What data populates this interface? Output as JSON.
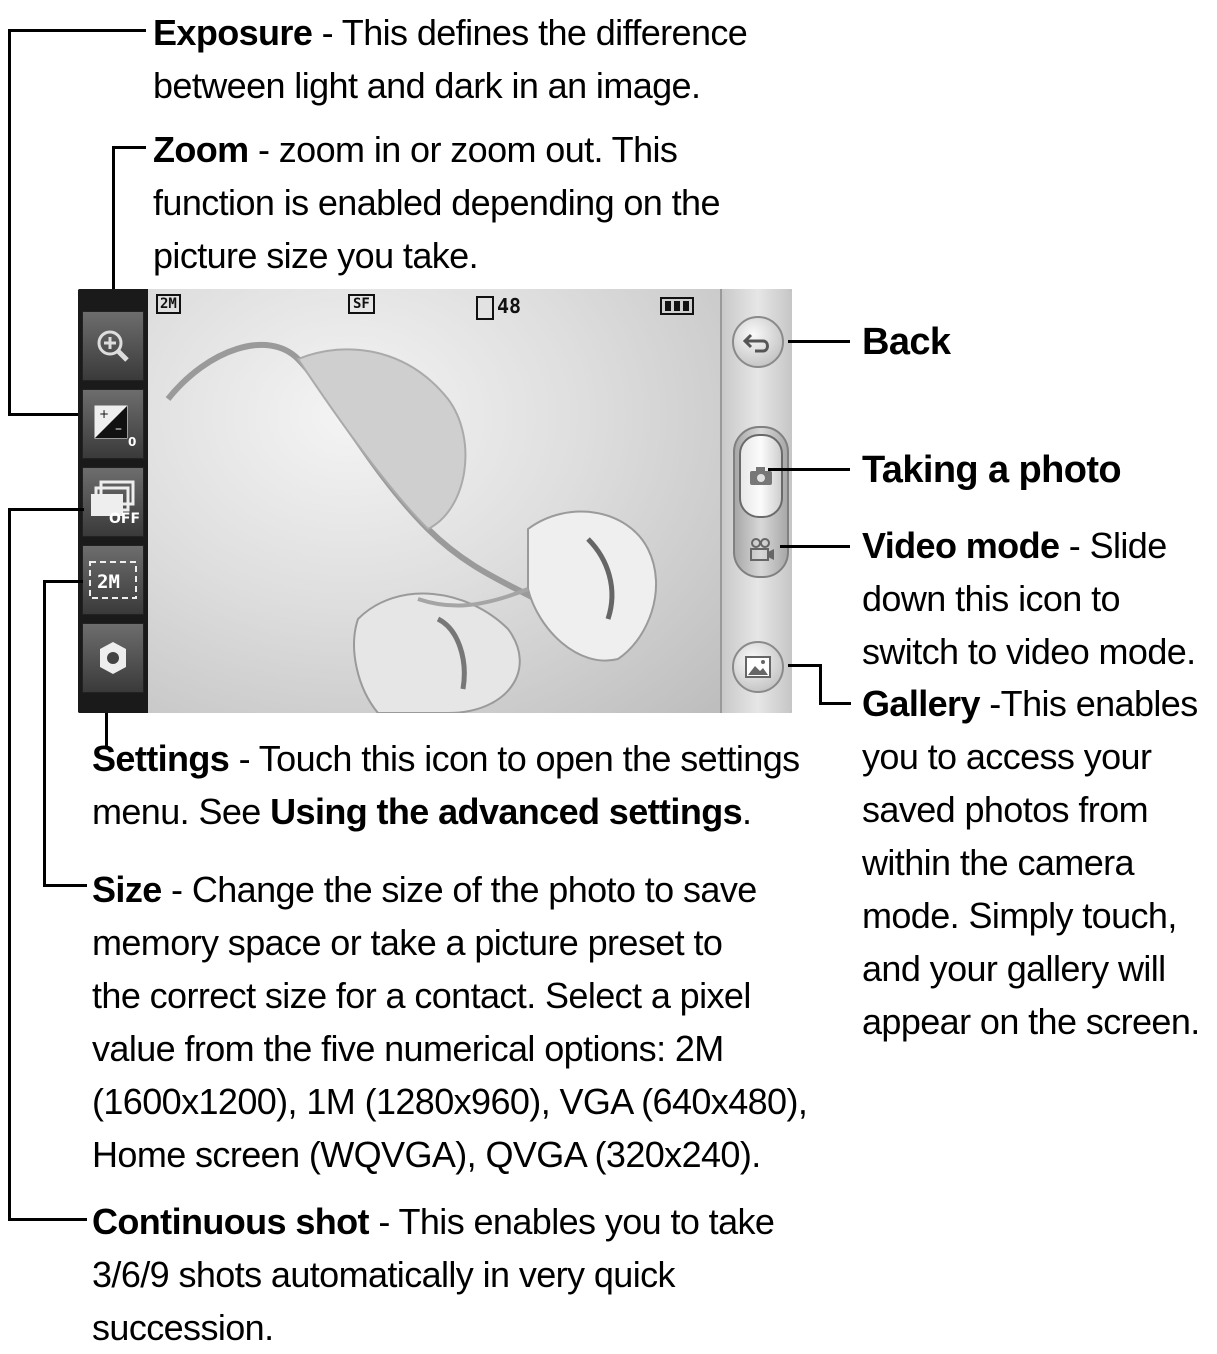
{
  "annotations": {
    "exposure": {
      "title": "Exposure",
      "text": " - This defines the difference",
      "text2": "between light and dark in an image."
    },
    "zoom": {
      "title": "Zoom",
      "text": " - zoom in or zoom out.  This",
      "text2": "function is enabled depending on the",
      "text3": "picture size you take."
    },
    "back": {
      "title": "Back"
    },
    "taking_photo": {
      "title": "Taking a photo"
    },
    "video_mode": {
      "title": "Video mode",
      "text": " - Slide",
      "text2": "down this icon to",
      "text3": "switch to video mode."
    },
    "gallery": {
      "title": "Gallery",
      "text": " -This enables",
      "lines": [
        "you to access your",
        "saved photos from",
        "within the camera",
        "mode. Simply touch,",
        "and your gallery will",
        "appear on the screen."
      ]
    },
    "settings": {
      "title": "Settings",
      "text": " - Touch this icon to open the settings",
      "text2a": "menu. See ",
      "link": "Using the advanced settings",
      "text2b": "."
    },
    "size": {
      "title": "Size",
      "text": " - Change the size of the photo to save",
      "lines": [
        "memory space or take a picture preset to",
        "the correct size for a contact. Select a pixel",
        "value from the five numerical options: 2M",
        "(1600x1200), 1M (1280x960), VGA (640x480),",
        "Home screen (WQVGA), QVGA (320x240)."
      ]
    },
    "continuous": {
      "title": "Continuous shot",
      "text": " - This enables you to take",
      "lines": [
        "3/6/9 shots automatically in very quick",
        "succession."
      ]
    }
  },
  "camera_screen": {
    "status": {
      "size": "2M",
      "quality": "SF",
      "shots_left": "48"
    },
    "left_buttons": {
      "exposure_value": "0",
      "continuous_value": "OFF",
      "size_value": "2M"
    }
  }
}
